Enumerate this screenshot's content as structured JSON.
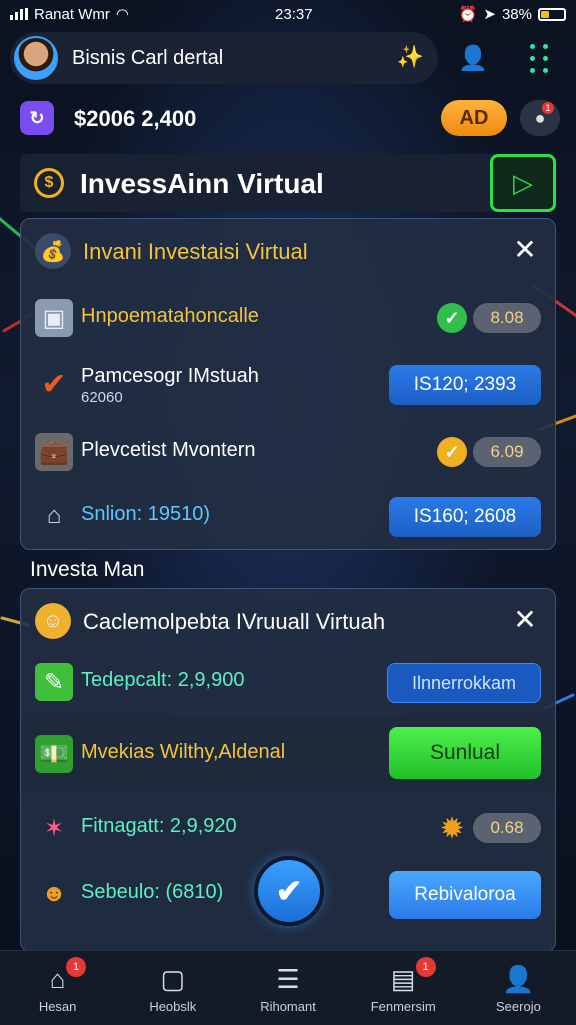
{
  "status_bar": {
    "carrier": "Ranat Wmr",
    "time": "23:37",
    "battery": "38%"
  },
  "header": {
    "title": "Bisnis Carl dertal"
  },
  "balance": {
    "amount": "$2006 2,400",
    "ad_label": "AD",
    "notif_count": "1"
  },
  "banner": {
    "title": "InvessAinn Virtual"
  },
  "panel1": {
    "title": "Invani Investaisi Virtual",
    "rows": [
      {
        "label": "Hnpoematahoncalle",
        "value": "8.08"
      },
      {
        "label": "Pamcesogr IMstuah",
        "sub": "62060",
        "button": "IS120; 2393"
      },
      {
        "label": "Plevcetist Mvontern",
        "value": "6.09"
      },
      {
        "label": "Snlion: 19510)",
        "button": "IS160; 2608"
      }
    ]
  },
  "section_label": "Investa Man",
  "panel2": {
    "title": "Caclemolpebta IVruuall Virtuah",
    "rows": [
      {
        "label": "Tedepcalt: 2,9,900",
        "button": "Ilnnerrokkam"
      },
      {
        "label": "Mvekias Wilthy,Aldenal",
        "button": "Sunlual"
      },
      {
        "label": "Fitnagatt: 2,9,920",
        "value": "0.68"
      },
      {
        "label": "Sebeulo: (6810)",
        "button": "Rebivaloroa"
      }
    ]
  },
  "bottom_nav": [
    {
      "label": "Hesan",
      "icon": "home-icon",
      "badge": "1"
    },
    {
      "label": "Heobslk",
      "icon": "edit-square-icon"
    },
    {
      "label": "Rihomant",
      "icon": "document-icon"
    },
    {
      "label": "Fenmersim",
      "icon": "inbox-icon",
      "badge": "1"
    },
    {
      "label": "Seerojo",
      "icon": "user-icon"
    }
  ],
  "colors": {
    "accent_blue": "#2a7ae8",
    "accent_green": "#2fdc4a",
    "accent_gold": "#f0b020",
    "ad_orange": "#f08a10"
  }
}
